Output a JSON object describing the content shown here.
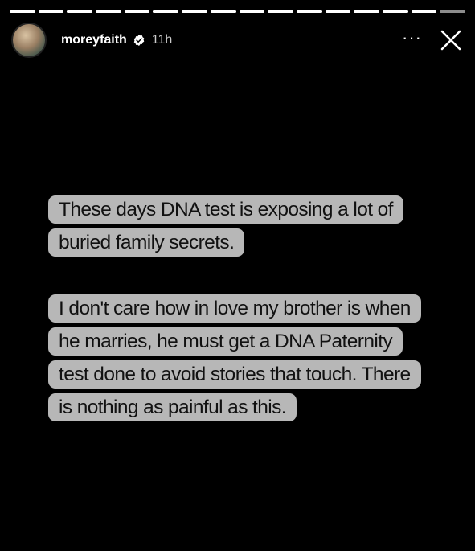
{
  "story": {
    "progress": {
      "segments_total": 16,
      "segments_seen": 15
    },
    "header": {
      "avatar_icon": "profile-photo",
      "username": "moreyfaith",
      "verified_icon": "verified-badge-icon",
      "time": "11h",
      "more_label": "···",
      "close_icon": "close-icon"
    },
    "caption": {
      "background_color": "#b7b7b7",
      "text_color": "#111111",
      "paragraphs": [
        "These days DNA test is exposing a lot of buried family secrets.",
        "I don't care how in love my brother is when he marries, he must get a DNA Paternity test done to avoid stories that touch. There is nothing as painful as this."
      ]
    }
  }
}
